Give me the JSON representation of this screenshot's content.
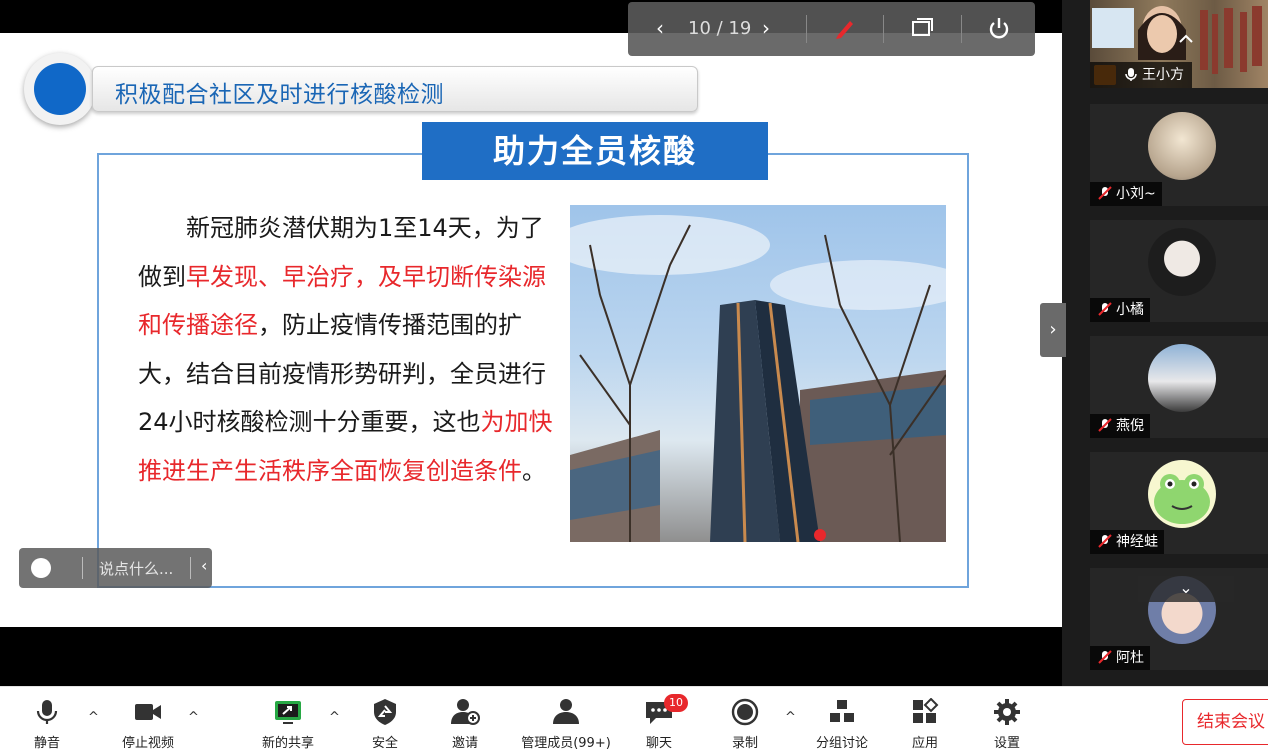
{
  "slide": {
    "section_title": "积极配合社区及时进行核酸检测",
    "heading": "助力全员核酸",
    "paragraph": [
      {
        "text": "新冠肺炎潜伏期为1至14天，为了做到",
        "red": false
      },
      {
        "text": "早发现、早治疗，及早切断传染源和传播途径",
        "red": true
      },
      {
        "text": "，防止疫情传播范围的扩大，结合目前疫情形势研判，全员进行24小时核酸检测十分重要，这也",
        "red": false
      },
      {
        "text": "为加快推进生产生活秩序全面恢复创造条件",
        "red": true
      },
      {
        "text": "。",
        "red": false
      }
    ]
  },
  "chat": {
    "placeholder": "说点什么..."
  },
  "share_toolbar": {
    "pager": "10 / 19"
  },
  "participants": [
    {
      "name": "王小方",
      "muted": false,
      "video": true
    },
    {
      "name": "小刘~",
      "muted": true
    },
    {
      "name": "小橘",
      "muted": true
    },
    {
      "name": "燕倪",
      "muted": true
    },
    {
      "name": "神经蛙",
      "muted": true
    },
    {
      "name": "阿杜",
      "muted": true
    }
  ],
  "toolbar": {
    "mute": "静音",
    "stop_video": "停止视频",
    "new_share": "新的共享",
    "security": "安全",
    "invite": "邀请",
    "manage": "管理成员(99+)",
    "chat": "聊天",
    "chat_badge": "10",
    "record": "录制",
    "breakout": "分组讨论",
    "apps": "应用",
    "settings": "设置",
    "end": "结束会议"
  },
  "colors": {
    "accent_blue": "#1f6ec5",
    "highlight_red": "#e8282c",
    "share_green": "#27a844"
  }
}
